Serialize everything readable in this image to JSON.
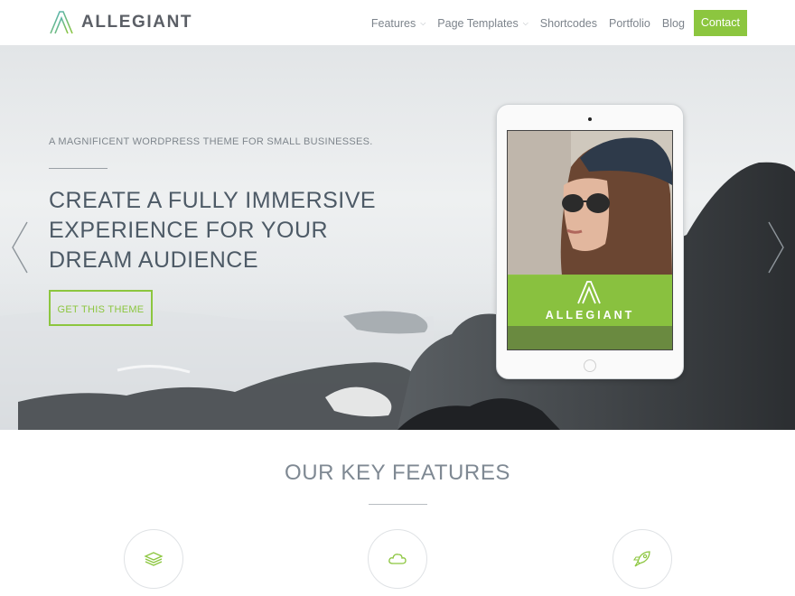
{
  "brand": {
    "name": "ALLEGIANT",
    "accent_color": "#8cc63f",
    "logo_icon": "allegiant-logo-icon"
  },
  "nav": {
    "items": [
      {
        "label": "Features",
        "has_dropdown": true
      },
      {
        "label": "Page Templates",
        "has_dropdown": true
      },
      {
        "label": "Shortcodes",
        "has_dropdown": false
      },
      {
        "label": "Portfolio",
        "has_dropdown": false
      },
      {
        "label": "Blog",
        "has_dropdown": false
      }
    ],
    "contact_label": "Contact"
  },
  "hero": {
    "tagline": "A MAGNIFICENT WORDPRESS THEME FOR SMALL BUSINESSES.",
    "headline": "CREATE A FULLY IMMERSIVE EXPERIENCE FOR YOUR DREAM AUDIENCE",
    "cta_label": "GET THIS THEME",
    "prev_icon": "chevron-left-icon",
    "next_icon": "chevron-right-icon",
    "tablet_screen_logo_text": "ALLEGIANT"
  },
  "features": {
    "title": "OUR KEY FEATURES",
    "icons": [
      "layers-icon",
      "cloud-icon",
      "rocket-icon"
    ]
  }
}
